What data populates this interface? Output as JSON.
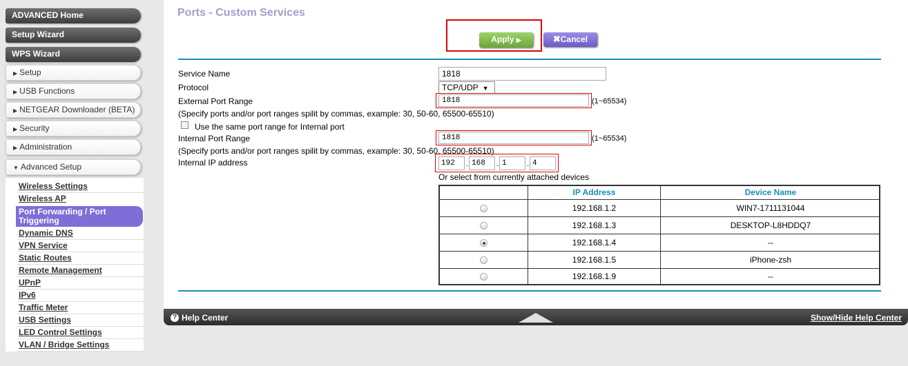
{
  "sidebar": {
    "top_buttons": [
      "ADVANCED Home",
      "Setup Wizard",
      "WPS Wizard"
    ],
    "sections": [
      "Setup",
      "USB Functions",
      "NETGEAR Downloader (BETA)",
      "Security",
      "Administration",
      "Advanced Setup"
    ],
    "advanced_setup_items": [
      "Wireless Settings",
      "Wireless AP",
      "Port Forwarding / Port Triggering",
      "Dynamic DNS",
      "VPN Service",
      "Static Routes",
      "Remote Management",
      "UPnP",
      "IPv6",
      "Traffic Meter",
      "USB Settings",
      "LED Control Settings",
      "VLAN / Bridge Settings"
    ],
    "active_item": "Port Forwarding / Port Triggering"
  },
  "main": {
    "title": "Ports - Custom Services",
    "apply_label": "Apply",
    "cancel_label": "Cancel",
    "form": {
      "service_name_label": "Service Name",
      "service_name_value": "1818",
      "protocol_label": "Protocol",
      "protocol_value": "TCP/UDP",
      "external_port_label": "External Port Range",
      "external_port_value": "1818",
      "range_note": "(1~65534)",
      "ports_hint": "(Specify ports and/or port ranges spilit by commas, example: 30, 50-60, 65500-65510)",
      "same_port_label": "Use the same port range for Internal port",
      "internal_port_label": "Internal Port Range",
      "internal_port_value": "1818",
      "internal_ip_label": "Internal IP address",
      "ip_octets": [
        "192",
        "168",
        "1",
        "4"
      ],
      "attached_note": "Or select from currently attached devices"
    },
    "devices_table": {
      "headers": [
        "IP Address",
        "Device Name"
      ],
      "rows": [
        {
          "ip": "192.168.1.2",
          "name": "WIN7-1711131044",
          "selected": false
        },
        {
          "ip": "192.168.1.3",
          "name": "DESKTOP-L8HDDQ7",
          "selected": false
        },
        {
          "ip": "192.168.1.4",
          "name": "--",
          "selected": true
        },
        {
          "ip": "192.168.1.5",
          "name": "iPhone-zsh",
          "selected": false
        },
        {
          "ip": "192.168.1.9",
          "name": "--",
          "selected": false
        }
      ]
    }
  },
  "help_bar": {
    "label": "Help Center",
    "toggle_label": "Show/Hide Help Center"
  }
}
